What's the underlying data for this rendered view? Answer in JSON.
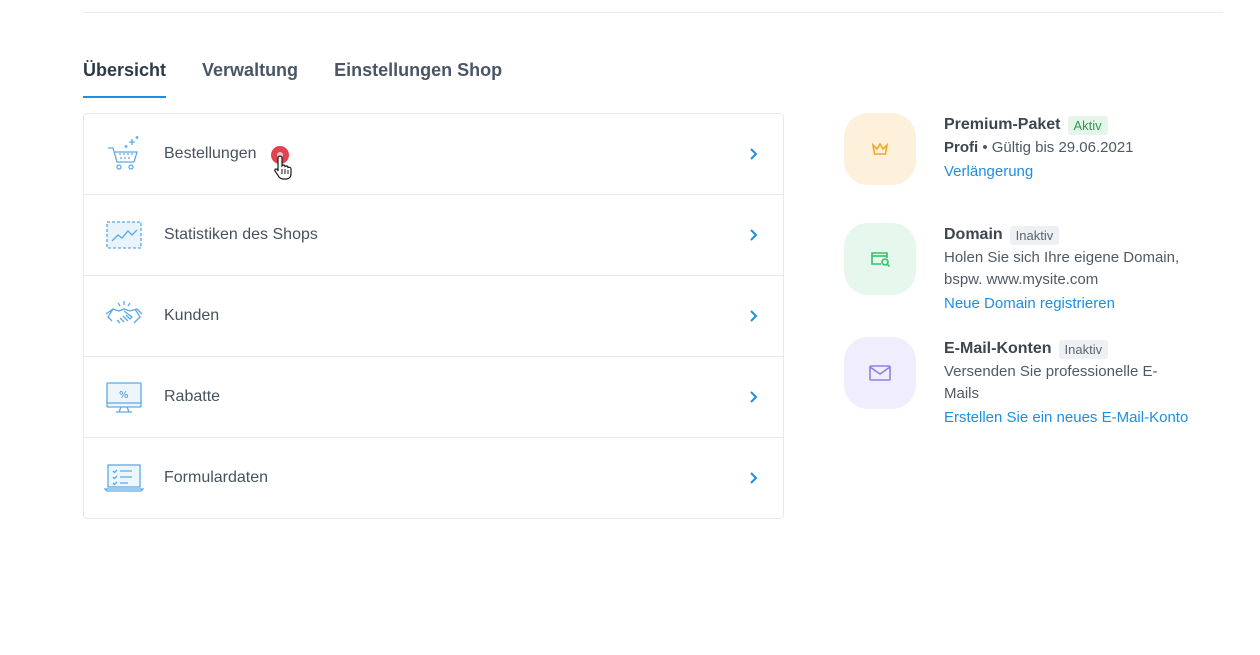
{
  "tabs": [
    {
      "label": "Übersicht",
      "active": true
    },
    {
      "label": "Verwaltung",
      "active": false
    },
    {
      "label": "Einstellungen Shop",
      "active": false
    }
  ],
  "menu": {
    "items": [
      {
        "label": "Bestellungen",
        "icon": "cart-icon",
        "has_badge": true
      },
      {
        "label": "Statistiken des Shops",
        "icon": "chart-icon"
      },
      {
        "label": "Kunden",
        "icon": "handshake-icon"
      },
      {
        "label": "Rabatte",
        "icon": "monitor-percent-icon"
      },
      {
        "label": "Formulardaten",
        "icon": "laptop-form-icon"
      }
    ]
  },
  "side": {
    "premium": {
      "title": "Premium-Paket",
      "status": "Aktiv",
      "plan": "Profi",
      "validity": " • Gültig bis 29.06.2021",
      "link": "Verlängerung",
      "icon": "crown-icon",
      "tile_color": "#fdf1dc"
    },
    "domain": {
      "title": "Domain",
      "status": "Inaktiv",
      "desc": "Holen Sie sich Ihre eigene Domain, bspw. www.mysite.com",
      "link": "Neue Domain registrieren",
      "icon": "domain-search-icon",
      "tile_color": "#e6f8ee"
    },
    "email": {
      "title": "E-Mail-Konten",
      "status": "Inaktiv",
      "desc": "Versenden Sie professionelle E-Mails",
      "link": "Erstellen Sie ein neues E-Mail-Konto",
      "icon": "envelope-icon",
      "tile_color": "#f0eefc"
    }
  },
  "colors": {
    "accent": "#1d8fe1",
    "badge": "#e1424f"
  }
}
